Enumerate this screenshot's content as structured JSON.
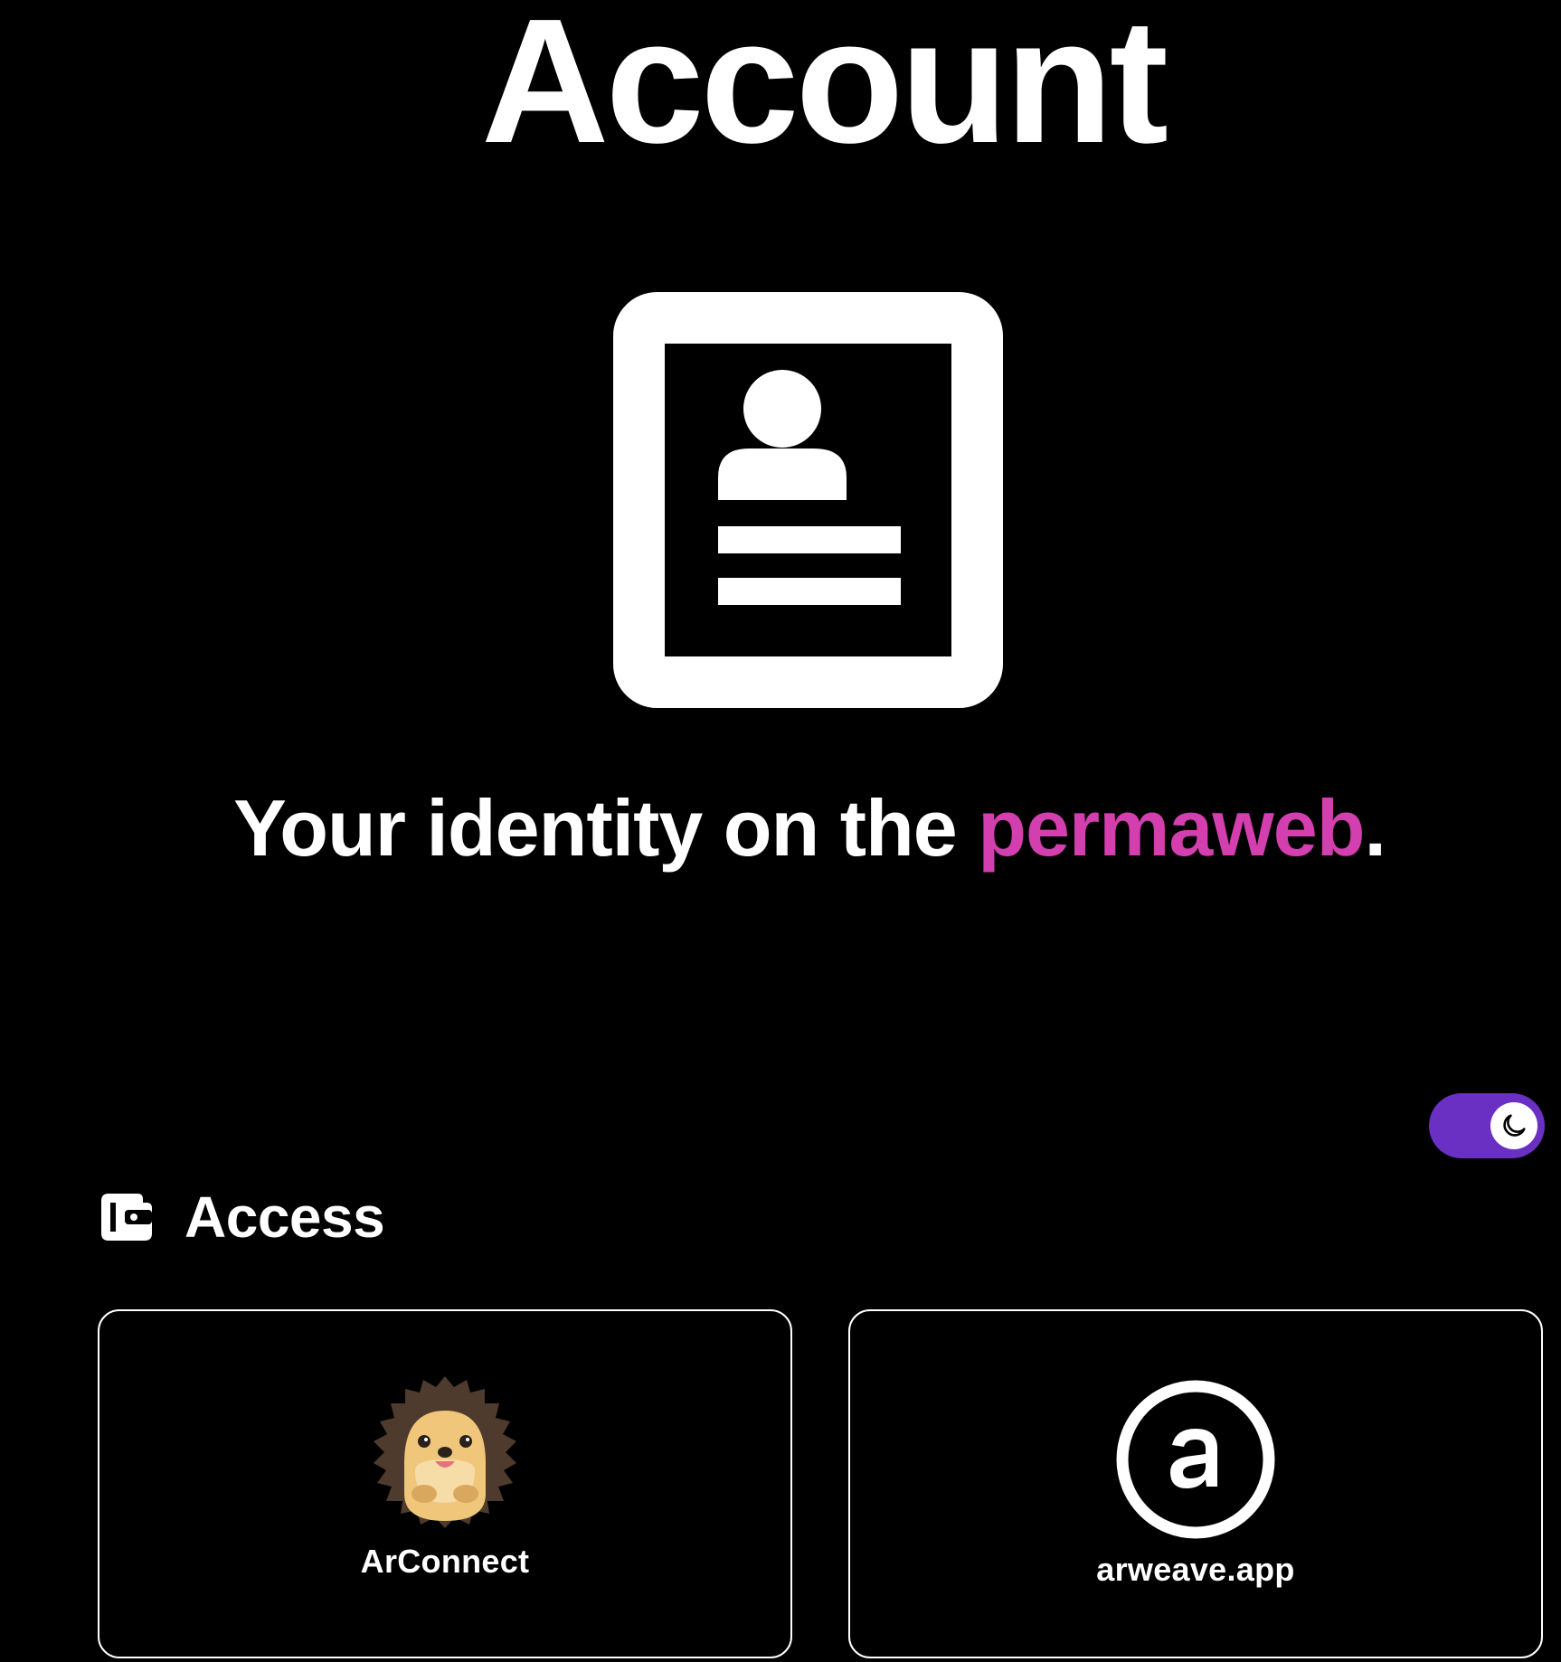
{
  "page": {
    "title": "Account",
    "tagline_prefix": "Your identity on the ",
    "tagline_accent": "permaweb",
    "tagline_suffix": ".",
    "hero_icon": "contact-card-icon"
  },
  "theme_toggle": {
    "state": "dark",
    "icon": "moon-icon"
  },
  "access_section": {
    "title": "Access",
    "icon": "wallet-icon",
    "options": [
      {
        "label": "ArConnect",
        "icon": "hedgehog-logo-icon"
      },
      {
        "label": "arweave.app",
        "icon": "arweave-logo-icon"
      }
    ]
  },
  "colors": {
    "background": "#000000",
    "text": "#ffffff",
    "accent": "#d33fae",
    "toggle": "#6a30c4"
  }
}
